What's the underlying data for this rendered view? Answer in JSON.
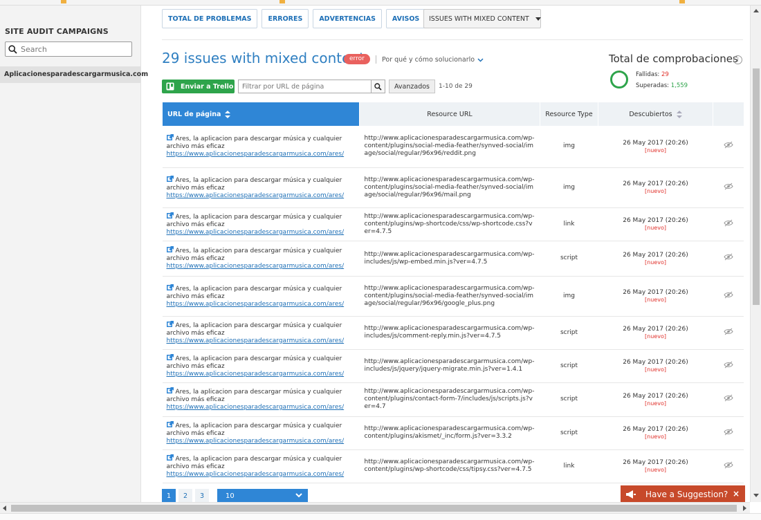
{
  "sidebar": {
    "heading": "SITE AUDIT CAMPAIGNS",
    "search_placeholder": "Search",
    "campaign": "Aplicacionesparadescargarmusica.com"
  },
  "tabs": {
    "total": "TOTAL DE PROBLEMAS",
    "errors": "ERRORES",
    "warnings": "ADVERTENCIAS",
    "notices": "AVISOS"
  },
  "issue_select": "ISSUES WITH MIXED CONTENT",
  "header": {
    "title": "29 issues with mixed content",
    "badge": "error",
    "why_link": "Por qué y cómo solucionarlo"
  },
  "checks": {
    "title": "Total de comprobaciones",
    "failed_label": "Fallidas:",
    "failed_value": "29",
    "passed_label": "Superadas:",
    "passed_value": "1,559"
  },
  "toolbar": {
    "trello": "Enviar a Trello",
    "filter_placeholder": "Filtrar por URL de página",
    "advanced": "Avanzados",
    "range": "1-10 de 29"
  },
  "table": {
    "headers": {
      "page": "URL de página",
      "resource": "Resource URL",
      "type": "Resource Type",
      "date": "Descubiertos"
    },
    "new_label": "[nuevo]",
    "rows": [
      {
        "title": "Ares, la aplicacion para descargar música y cualquier archivo más eficaz",
        "url": "https://www.aplicacionesparadescargarmusica.com/ares/",
        "resource": "http://www.aplicacionesparadescargarmusica.com/wp-content/plugins/social-media-feather/synved-social/image/social/regular/96x96/reddit.png",
        "type": "img",
        "date": "26 May 2017 (20:26)"
      },
      {
        "title": "Ares, la aplicacion para descargar música y cualquier archivo más eficaz",
        "url": "https://www.aplicacionesparadescargarmusica.com/ares/",
        "resource": "http://www.aplicacionesparadescargarmusica.com/wp-content/plugins/social-media-feather/synved-social/image/social/regular/96x96/mail.png",
        "type": "img",
        "date": "26 May 2017 (20:26)"
      },
      {
        "title": "Ares, la aplicacion para descargar música y cualquier archivo más eficaz",
        "url": "https://www.aplicacionesparadescargarmusica.com/ares/",
        "resource": "http://www.aplicacionesparadescargarmusica.com/wp-content/plugins/wp-shortcode/css/wp-shortcode.css?ver=4.7.5",
        "type": "link",
        "date": "26 May 2017 (20:26)"
      },
      {
        "title": "Ares, la aplicacion para descargar música y cualquier archivo más eficaz",
        "url": "https://www.aplicacionesparadescargarmusica.com/ares/",
        "resource": "http://www.aplicacionesparadescargarmusica.com/wp-includes/js/wp-embed.min.js?ver=4.7.5",
        "type": "script",
        "date": "26 May 2017 (20:26)"
      },
      {
        "title": "Ares, la aplicacion para descargar música y cualquier archivo más eficaz",
        "url": "https://www.aplicacionesparadescargarmusica.com/ares/",
        "resource": "http://www.aplicacionesparadescargarmusica.com/wp-content/plugins/social-media-feather/synved-social/image/social/regular/96x96/google_plus.png",
        "type": "img",
        "date": "26 May 2017 (20:26)"
      },
      {
        "title": "Ares, la aplicacion para descargar música y cualquier archivo más eficaz",
        "url": "https://www.aplicacionesparadescargarmusica.com/ares/",
        "resource": "http://www.aplicacionesparadescargarmusica.com/wp-includes/js/comment-reply.min.js?ver=4.7.5",
        "type": "script",
        "date": "26 May 2017 (20:26)"
      },
      {
        "title": "Ares, la aplicacion para descargar música y cualquier archivo más eficaz",
        "url": "https://www.aplicacionesparadescargarmusica.com/ares/",
        "resource": "http://www.aplicacionesparadescargarmusica.com/wp-includes/js/jquery/jquery-migrate.min.js?ver=1.4.1",
        "type": "script",
        "date": "26 May 2017 (20:26)"
      },
      {
        "title": "Ares, la aplicacion para descargar música y cualquier archivo más eficaz",
        "url": "https://www.aplicacionesparadescargarmusica.com/ares/",
        "resource": "http://www.aplicacionesparadescargarmusica.com/wp-content/plugins/contact-form-7/includes/js/scripts.js?ver=4.7",
        "type": "script",
        "date": "26 May 2017 (20:26)"
      },
      {
        "title": "Ares, la aplicacion para descargar música y cualquier archivo más eficaz",
        "url": "https://www.aplicacionesparadescargarmusica.com/ares/",
        "resource": "http://www.aplicacionesparadescargarmusica.com/wp-content/plugins/akismet/_inc/form.js?ver=3.3.2",
        "type": "script",
        "date": "26 May 2017 (20:26)"
      },
      {
        "title": "Ares, la aplicacion para descargar música y cualquier archivo más eficaz",
        "url": "https://www.aplicacionesparadescargarmusica.com/ares/",
        "resource": "http://www.aplicacionesparadescargarmusica.com/wp-content/plugins/wp-shortcode/css/tipsy.css?ver=4.7.5",
        "type": "link",
        "date": "26 May 2017 (20:26)"
      }
    ]
  },
  "pagination": {
    "pages": [
      "1",
      "2",
      "3"
    ],
    "per_page": "10"
  },
  "suggestion": "Have a Suggestion?",
  "colors": {
    "accent": "#2f86d6",
    "link": "#1d6fb6",
    "error": "#e9615e",
    "success": "#2ea44b",
    "suggestion": "#c7492a"
  }
}
